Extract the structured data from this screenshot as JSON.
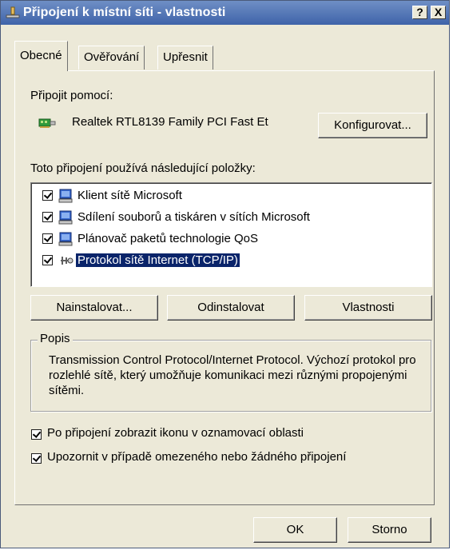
{
  "window": {
    "title": "Připojení k místní síti - vlastnosti",
    "help_label": "?",
    "close_label": "X"
  },
  "tabs": [
    {
      "label": "Obecné",
      "active": true
    },
    {
      "label": "Ověřování",
      "active": false
    },
    {
      "label": "Upřesnit",
      "active": false
    }
  ],
  "general": {
    "connect_using_label": "Připojit pomocí:",
    "adapter_name": "Realtek RTL8139 Family PCI Fast Et",
    "configure_button": "Konfigurovat...",
    "items_label": "Toto připojení používá následující položky:",
    "items": [
      {
        "label": "Klient sítě Microsoft",
        "checked": true,
        "icon": "client-icon",
        "selected": false
      },
      {
        "label": "Sdílení souborů a tiskáren v sítích Microsoft",
        "checked": true,
        "icon": "file-sharing-icon",
        "selected": false
      },
      {
        "label": "Plánovač paketů technologie QoS",
        "checked": true,
        "icon": "qos-scheduler-icon",
        "selected": false
      },
      {
        "label": "Protokol sítě Internet (TCP/IP)",
        "checked": true,
        "icon": "protocol-icon",
        "selected": true
      }
    ],
    "install_button": "Nainstalovat...",
    "uninstall_button": "Odinstalovat",
    "properties_button": "Vlastnosti",
    "description_title": "Popis",
    "description_text": "Transmission Control Protocol/Internet Protocol. Výchozí protokol pro rozlehlé sítě, který umožňuje komunikaci mezi různými propojenými sítěmi.",
    "show_icon_label": "Po připojení zobrazit ikonu v oznamovací oblasti",
    "show_icon_checked": true,
    "notify_label": "Upozornit v případě omezeného nebo žádného připojení",
    "notify_checked": true
  },
  "footer": {
    "ok_button": "OK",
    "cancel_button": "Storno"
  },
  "colors": {
    "selection": "#0a246a",
    "dialog_bg": "#ece9d8",
    "titlebar": "#3f63a9"
  }
}
